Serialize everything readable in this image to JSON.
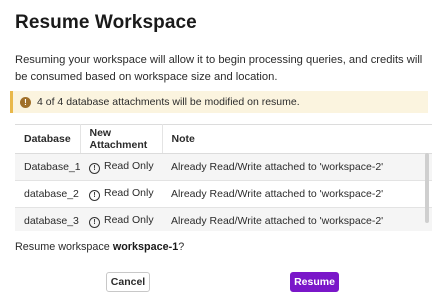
{
  "dialog": {
    "title": "Resume Workspace",
    "description": "Resuming your workspace will allow it to begin processing queries, and credits will be consumed based on workspace size and location.",
    "banner": {
      "icon": "info-icon",
      "text": "4 of 4 database attachments will be modified on resume.",
      "accent_color": "#e9b84a",
      "background_color": "#fbf4df"
    },
    "table": {
      "columns": [
        "Database",
        "New Attachment",
        "Note"
      ],
      "rows": [
        {
          "database": "Database_1",
          "attachment": "Read Only",
          "note": "Already Read/Write attached to 'workspace-2'"
        },
        {
          "database": "database_2",
          "attachment": "Read Only",
          "note": "Already Read/Write attached to 'workspace-2'"
        },
        {
          "database": "database_3",
          "attachment": "Read Only",
          "note": "Already Read/Write attached to 'workspace-2'"
        }
      ]
    },
    "confirm": {
      "prefix": "Resume workspace ",
      "workspace": "workspace-1",
      "suffix": "?"
    },
    "buttons": {
      "cancel_label": "Cancel",
      "resume_label": "Resume",
      "resume_color": "#7a17c9"
    }
  }
}
